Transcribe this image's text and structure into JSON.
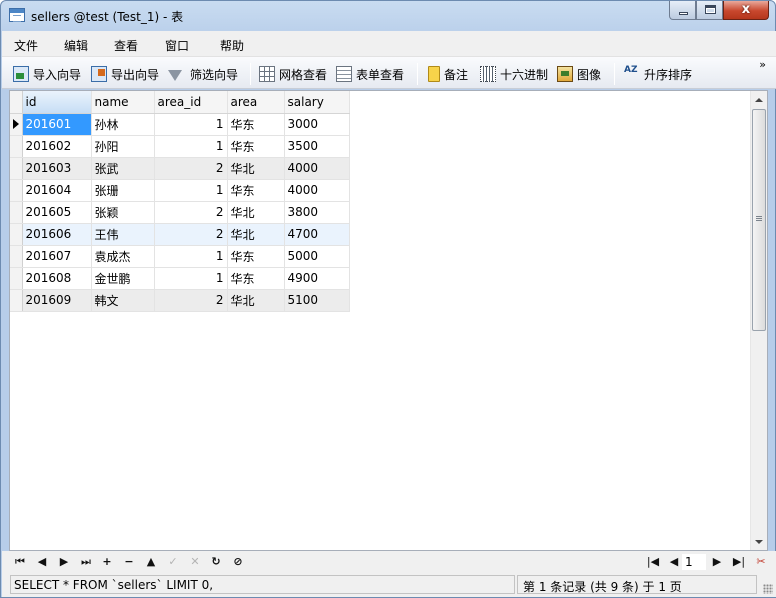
{
  "window": {
    "title": "sellers @test (Test_1) - 表",
    "close_glyph": "x"
  },
  "menu": [
    "文件",
    "编辑",
    "查看",
    "窗口",
    "帮助"
  ],
  "toolbar": {
    "import_label": "导入向导",
    "export_label": "导出向导",
    "filter_label": "筛选向导",
    "grid_label": "网格查看",
    "form_label": "表单查看",
    "memo_label": "备注",
    "hex_label": "十六进制",
    "image_label": "图像",
    "sort_label": "升序排序",
    "sort_icon_text": "AZ",
    "more_glyph": "»"
  },
  "table": {
    "columns": [
      "id",
      "name",
      "area_id",
      "area",
      "salary"
    ],
    "rows": [
      [
        "201601",
        "孙林",
        "1",
        "华东",
        "3000"
      ],
      [
        "201602",
        "孙阳",
        "1",
        "华东",
        "3500"
      ],
      [
        "201603",
        "张武",
        "2",
        "华北",
        "4000"
      ],
      [
        "201604",
        "张珊",
        "1",
        "华东",
        "4000"
      ],
      [
        "201605",
        "张颖",
        "2",
        "华北",
        "3800"
      ],
      [
        "201606",
        "王伟",
        "2",
        "华北",
        "4700"
      ],
      [
        "201607",
        "袁成杰",
        "1",
        "华东",
        "5000"
      ],
      [
        "201608",
        "金世鹏",
        "1",
        "华东",
        "4900"
      ],
      [
        "201609",
        "韩文",
        "2",
        "华北",
        "5100"
      ]
    ],
    "selected_row": 0,
    "selected_col": 0
  },
  "navigator": {
    "first": "⏮",
    "prev": "◀",
    "next": "▶",
    "last": "⏭",
    "add": "+",
    "delete": "−",
    "up": "▲",
    "apply": "✓",
    "cancel": "✕",
    "refresh": "↻",
    "stop": "⊘",
    "page_first": "|◀",
    "page_prev": "◀",
    "page_value": "1",
    "page_next": "▶",
    "page_last": "▶|",
    "settings": "✂"
  },
  "status": {
    "sql": "SELECT * FROM `sellers` LIMIT 0,",
    "record": "第 1 条记录 (共 9 条) 于 1 页"
  }
}
